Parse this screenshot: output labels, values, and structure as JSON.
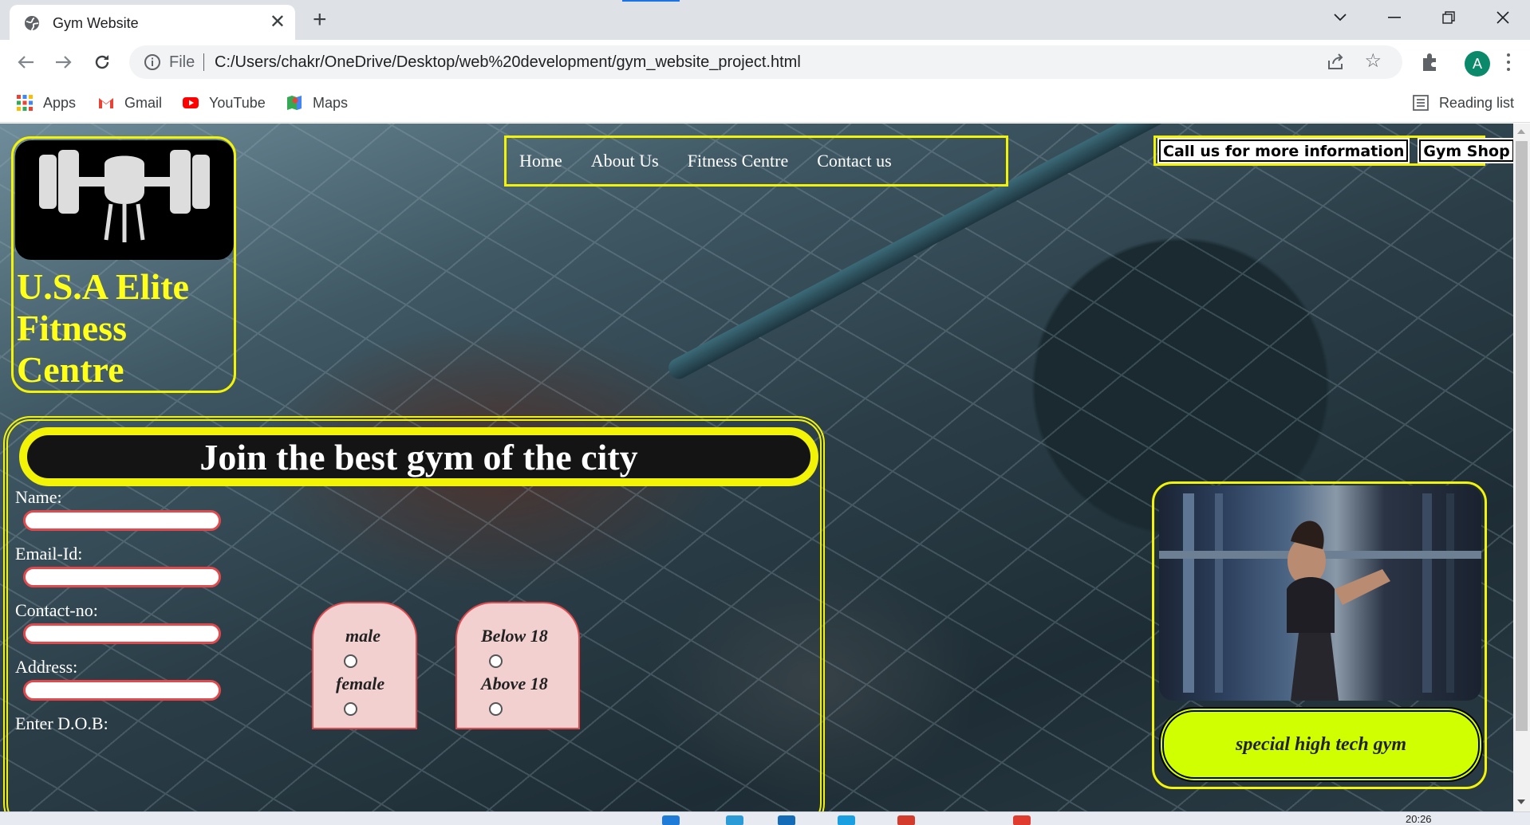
{
  "browser": {
    "tab_title": "Gym Website",
    "new_tab_symbol": "+",
    "url_scheme": "File",
    "url": "C:/Users/chakr/OneDrive/Desktop/web%20development/gym_website_project.html",
    "profile_initial": "A",
    "bookmarks": [
      {
        "label": "Apps",
        "icon": "apps-grid-icon"
      },
      {
        "label": "Gmail",
        "icon": "gmail-icon"
      },
      {
        "label": "YouTube",
        "icon": "youtube-icon"
      },
      {
        "label": "Maps",
        "icon": "maps-icon"
      }
    ],
    "reading_list": "Reading list"
  },
  "page": {
    "gym_name": "U.S.A Elite Fitness Centre",
    "nav": [
      "Home",
      "About Us",
      "Fitness Centre",
      "Contact us"
    ],
    "cta_call": "Call us for more information",
    "cta_shop": "Gym Shop",
    "banner": "Join the best gym of the city",
    "form": {
      "name_label": "Name:",
      "email_label": "Email-Id:",
      "contact_label": "Contact-no:",
      "address_label": "Address:",
      "dob_label": "Enter D.O.B:"
    },
    "gender_options": [
      "male",
      "female"
    ],
    "age_options": [
      "Below 18",
      "Above 18"
    ],
    "side_card_caption": "special high tech gym"
  },
  "taskbar": {
    "clock": "20:26"
  },
  "colors": {
    "accent_yellow": "#f3f307",
    "input_border": "#e2494d",
    "lime": "#cfff00"
  }
}
